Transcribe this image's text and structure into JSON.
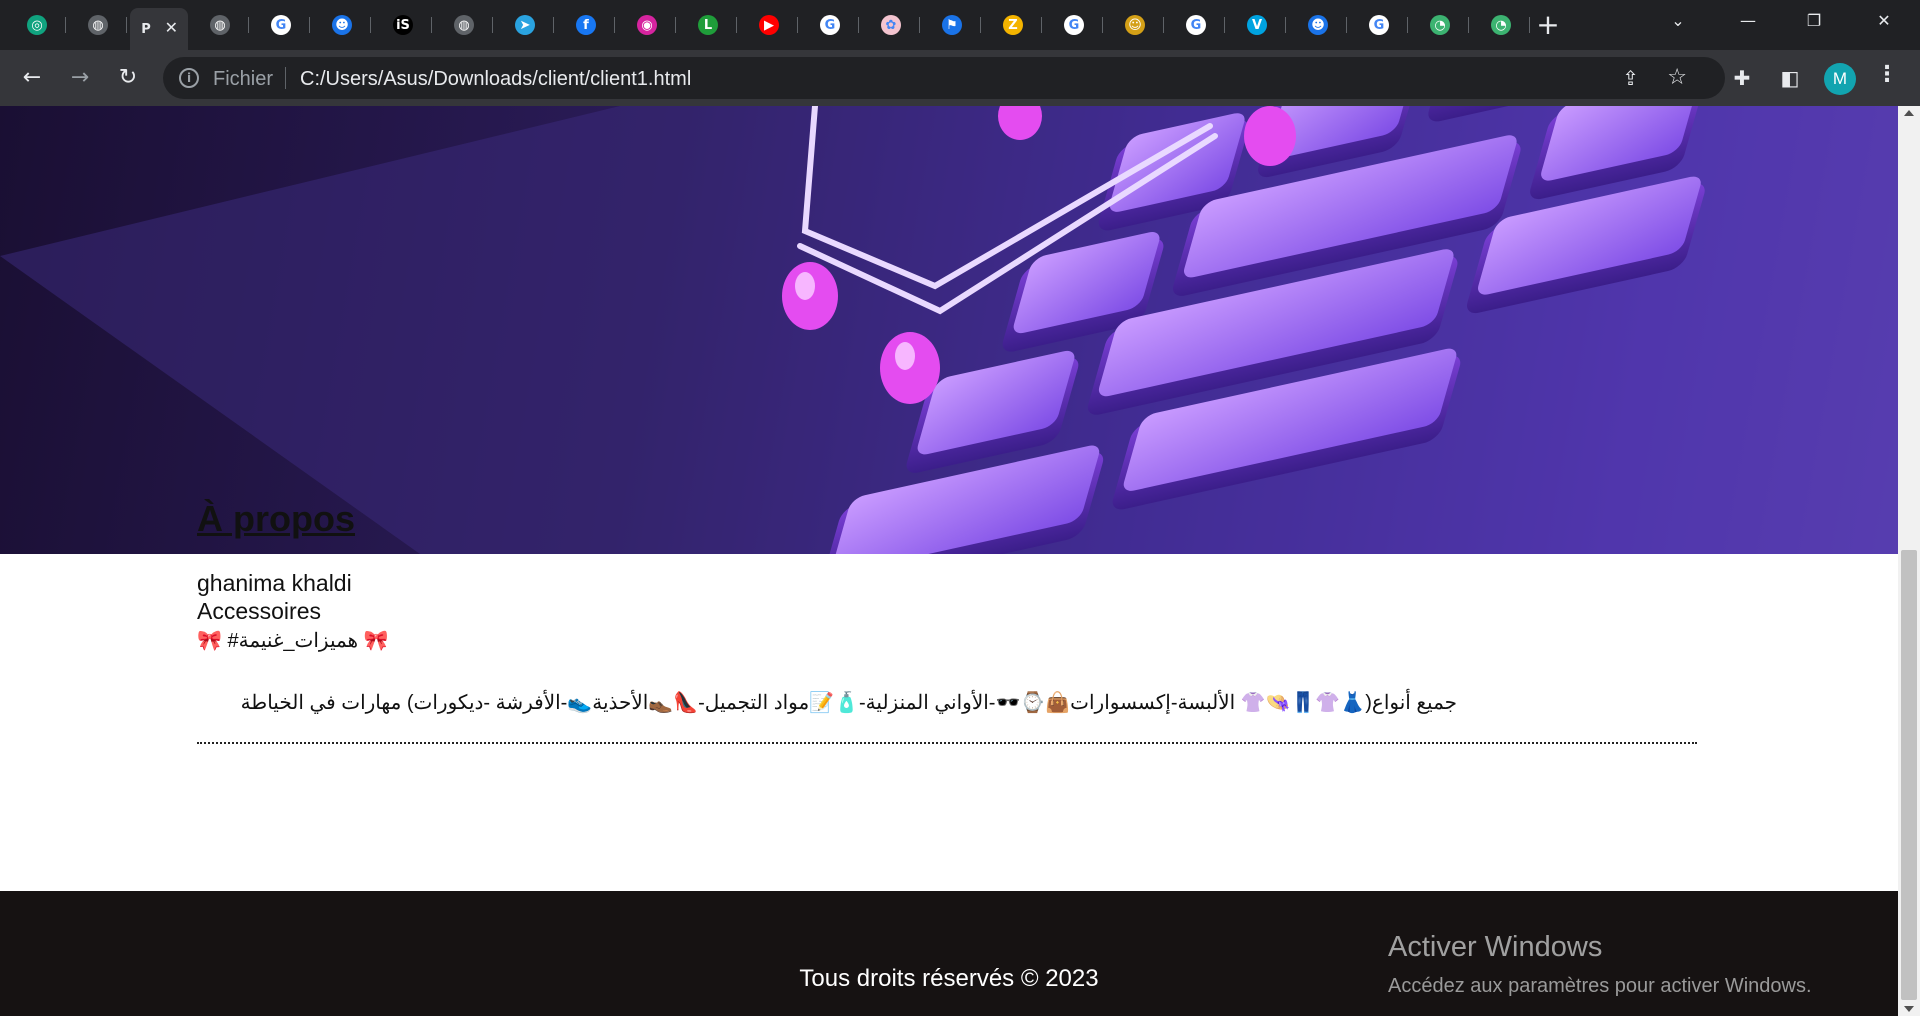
{
  "browser": {
    "tabs": [
      {
        "icon": "chatgpt-icon",
        "color": "#10a37f",
        "glyph": "◎"
      },
      {
        "icon": "globe-icon",
        "color": "#5f6368",
        "glyph": "◍"
      },
      {
        "icon": "page-icon",
        "color": "#35363a",
        "glyph": "P",
        "active": true
      },
      {
        "icon": "globe-icon",
        "color": "#5f6368",
        "glyph": "◍"
      },
      {
        "icon": "google-icon",
        "color": "#ffffff",
        "glyph": "G"
      },
      {
        "icon": "bot-icon",
        "color": "#1a73e8",
        "glyph": "☻"
      },
      {
        "icon": "is-icon",
        "color": "#000000",
        "glyph": "iS"
      },
      {
        "icon": "globe-icon",
        "color": "#5f6368",
        "glyph": "◍"
      },
      {
        "icon": "telegram-icon",
        "color": "#2aa3e0",
        "glyph": "➤"
      },
      {
        "icon": "facebook-icon",
        "color": "#1877f2",
        "glyph": "f"
      },
      {
        "icon": "instagram-icon",
        "color": "#d6249f",
        "glyph": "◉"
      },
      {
        "icon": "l-icon",
        "color": "#1f9d3a",
        "glyph": "L"
      },
      {
        "icon": "youtube-icon",
        "color": "#ff0000",
        "glyph": "▶"
      },
      {
        "icon": "google-icon",
        "color": "#ffffff",
        "glyph": "G"
      },
      {
        "icon": "pink-logo-icon",
        "color": "#f3c4cf",
        "glyph": "✿"
      },
      {
        "icon": "flag-icon",
        "color": "#1a73e8",
        "glyph": "⚑"
      },
      {
        "icon": "z-icon",
        "color": "#f4b400",
        "glyph": "Z"
      },
      {
        "icon": "google-icon",
        "color": "#ffffff",
        "glyph": "G"
      },
      {
        "icon": "ghost-icon",
        "color": "#d4a017",
        "glyph": "☺"
      },
      {
        "icon": "google-icon",
        "color": "#ffffff",
        "glyph": "G"
      },
      {
        "icon": "v-icon",
        "color": "#00a3e0",
        "glyph": "V"
      },
      {
        "icon": "bot-icon",
        "color": "#1a73e8",
        "glyph": "☻"
      },
      {
        "icon": "google-icon",
        "color": "#ffffff",
        "glyph": "G"
      },
      {
        "icon": "green-chat-icon",
        "color": "#3cb371",
        "glyph": "◔"
      },
      {
        "icon": "green-chat-icon",
        "color": "#3cb371",
        "glyph": "◔"
      }
    ],
    "scheme_label": "Fichier",
    "url": "C:/Users/Asus/Downloads/client/client1.html",
    "avatar_letter": "M"
  },
  "about": {
    "title": "À propos",
    "name": "ghanima khaldi",
    "category": "Accessoires",
    "tag": "🎀 #هميزات_غنيمة 🎀",
    "description": "جميع أنواع(👗👚👖👒👚 الألبسة-إكسسوارات👜⌚🕶️-الأواني المنزلية-🧴📝مواد التجميل-👠👞الأحذية👟-الأفرشة -ديكورات) مهارات في الخياطة"
  },
  "footer": {
    "copyright": "Tous droits réservés © 2023"
  },
  "windows_watermark": {
    "title": "Activer Windows",
    "subtitle": "Accédez aux paramètres pour activer Windows."
  }
}
